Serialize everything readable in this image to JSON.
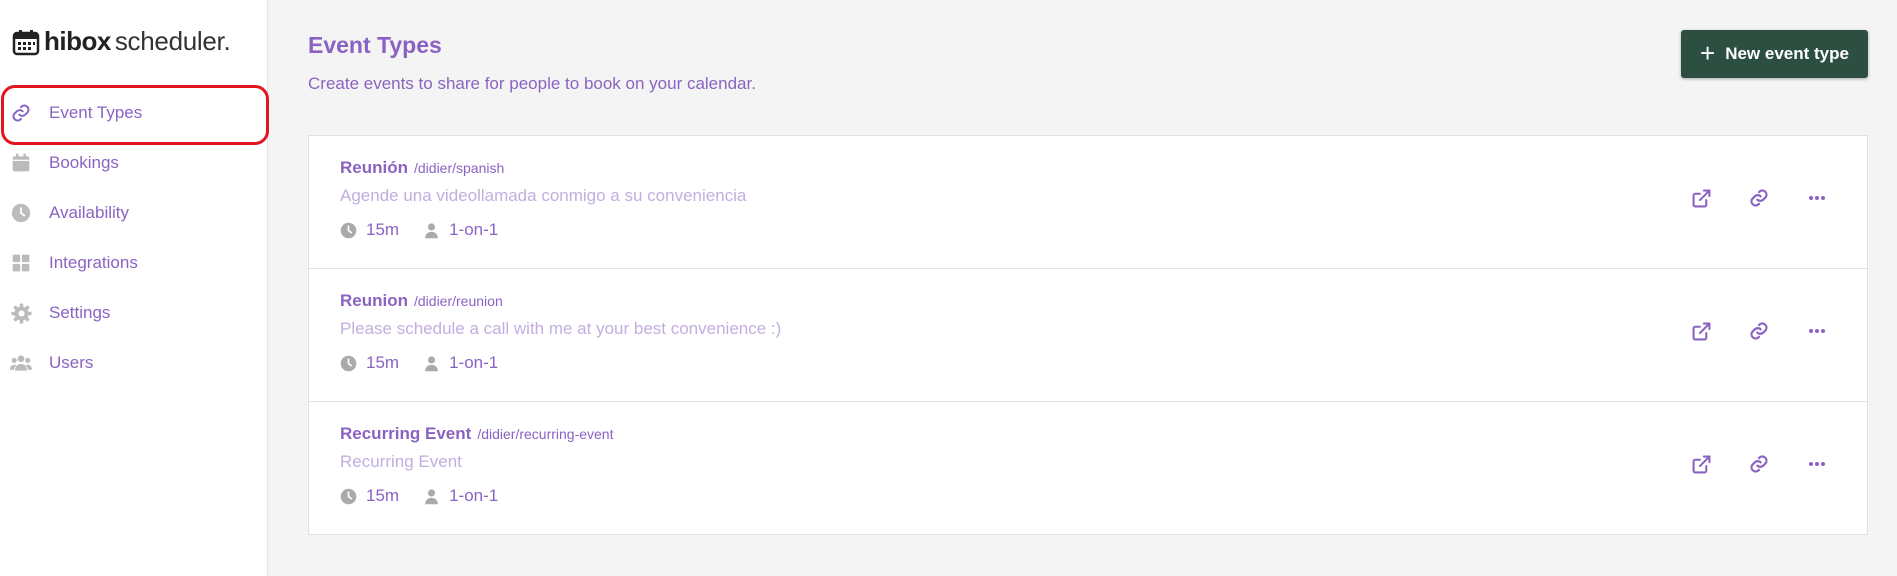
{
  "app": {
    "logo_bold": "hibox",
    "logo_light": "scheduler."
  },
  "sidebar": {
    "items": [
      {
        "label": "Event Types",
        "icon": "link-icon",
        "active": true
      },
      {
        "label": "Bookings",
        "icon": "calendar-icon"
      },
      {
        "label": "Availability",
        "icon": "clock-icon"
      },
      {
        "label": "Integrations",
        "icon": "grid-icon"
      },
      {
        "label": "Settings",
        "icon": "gear-icon"
      },
      {
        "label": "Users",
        "icon": "users-icon"
      }
    ]
  },
  "header": {
    "title": "Event Types",
    "subtitle": "Create events to share for people to book on your calendar.",
    "new_button_label": "New event type"
  },
  "events": [
    {
      "title": "Reunión",
      "slug": "/didier/spanish",
      "description": "Agende una videollamada conmigo a su conveniencia",
      "duration": "15m",
      "type": "1-on-1"
    },
    {
      "title": "Reunion",
      "slug": "/didier/reunion",
      "description": "Please schedule a call with me at your best convenience :)",
      "duration": "15m",
      "type": "1-on-1"
    },
    {
      "title": "Recurring Event",
      "slug": "/didier/recurring-event",
      "description": "Recurring Event",
      "duration": "15m",
      "type": "1-on-1"
    }
  ],
  "colors": {
    "accent": "#8a63c2",
    "button_bg": "#2d4f41",
    "highlight_ring": "#e0151f"
  }
}
